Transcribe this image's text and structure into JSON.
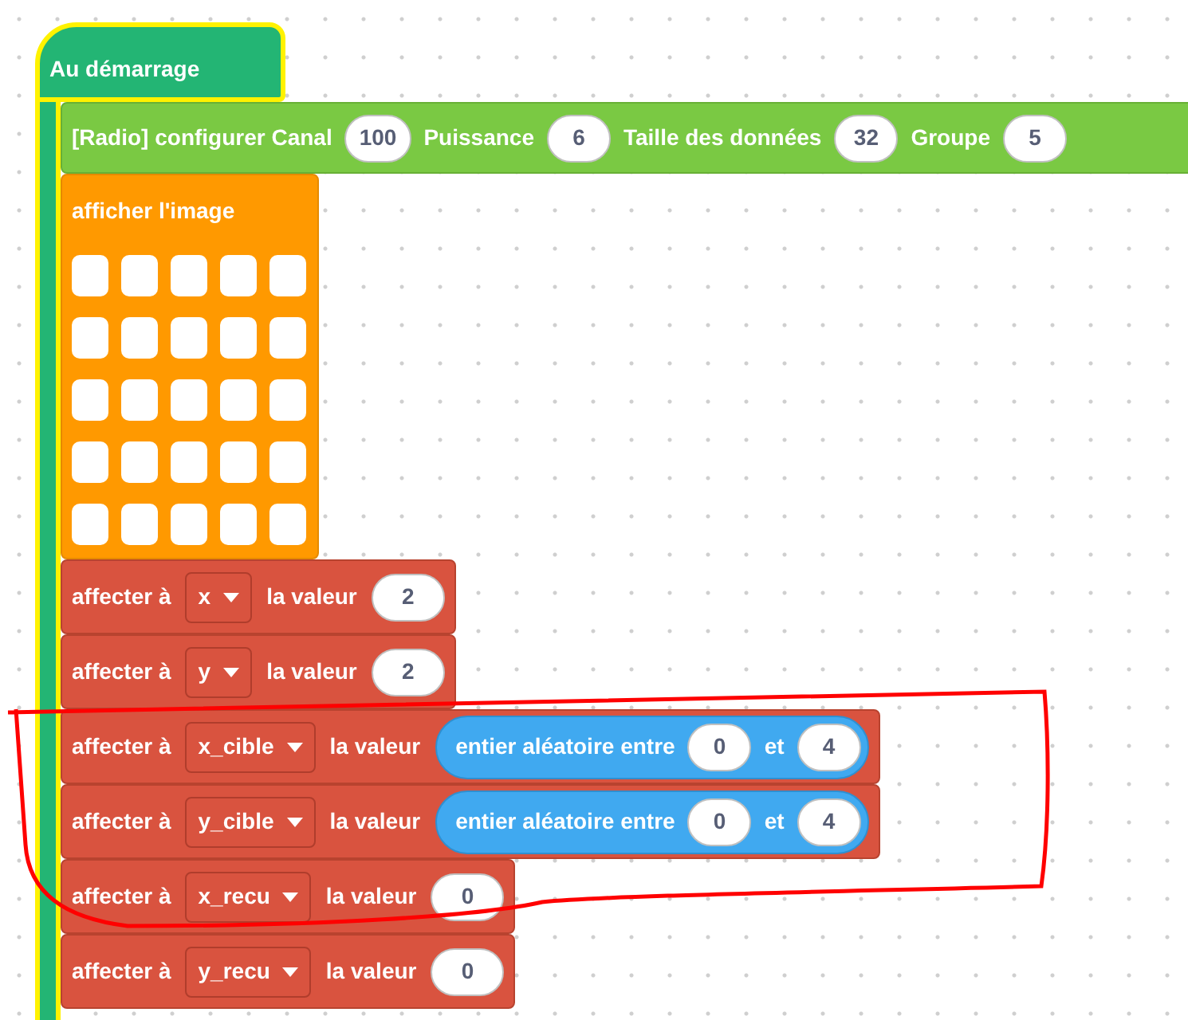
{
  "hat": {
    "label": "Au démarrage",
    "highlighted": true
  },
  "radio": {
    "segments": [
      {
        "kind": "text",
        "text": "[Radio] configurer Canal"
      },
      {
        "kind": "number",
        "text": "100"
      },
      {
        "kind": "text",
        "text": "Puissance"
      },
      {
        "kind": "number",
        "text": "6"
      },
      {
        "kind": "text",
        "text": "Taille des données"
      },
      {
        "kind": "number",
        "text": "32"
      },
      {
        "kind": "text",
        "text": "Groupe"
      },
      {
        "kind": "number",
        "text": "5"
      }
    ]
  },
  "image": {
    "label": "afficher l'image",
    "leds": [
      [
        {
          "on": false
        },
        {
          "on": false
        },
        {
          "on": false
        },
        {
          "on": false
        },
        {
          "on": false
        }
      ],
      [
        {
          "on": false
        },
        {
          "on": false
        },
        {
          "on": false
        },
        {
          "on": false
        },
        {
          "on": false
        }
      ],
      [
        {
          "on": false
        },
        {
          "on": false
        },
        {
          "on": false
        },
        {
          "on": false
        },
        {
          "on": false
        }
      ],
      [
        {
          "on": false
        },
        {
          "on": false
        },
        {
          "on": false
        },
        {
          "on": false
        },
        {
          "on": false
        }
      ],
      [
        {
          "on": false
        },
        {
          "on": false
        },
        {
          "on": false
        },
        {
          "on": false
        },
        {
          "on": false
        }
      ]
    ]
  },
  "assignments": [
    {
      "label": "affecter à",
      "variable": "x",
      "label_value": "la valeur",
      "value": {
        "kind": "number",
        "text": "2"
      }
    },
    {
      "label": "affecter à",
      "variable": "y",
      "label_value": "la valeur",
      "value": {
        "kind": "number",
        "text": "2"
      }
    },
    {
      "label": "affecter à",
      "variable": "x_cible",
      "label_value": "la valeur",
      "value": {
        "kind": "random",
        "label": "entier aléatoire entre",
        "min": "0",
        "joiner": "et",
        "max": "4"
      }
    },
    {
      "label": "affecter à",
      "variable": "y_cible",
      "label_value": "la valeur",
      "value": {
        "kind": "random",
        "label": "entier aléatoire entre",
        "min": "0",
        "joiner": "et",
        "max": "4"
      }
    },
    {
      "label": "affecter à",
      "variable": "x_recu",
      "label_value": "la valeur",
      "value": {
        "kind": "number",
        "text": "0"
      }
    },
    {
      "label": "affecter à",
      "variable": "y_recu",
      "label_value": "la valeur",
      "value": {
        "kind": "number",
        "text": "0"
      }
    }
  ],
  "annotation": {
    "kind": "loop"
  }
}
